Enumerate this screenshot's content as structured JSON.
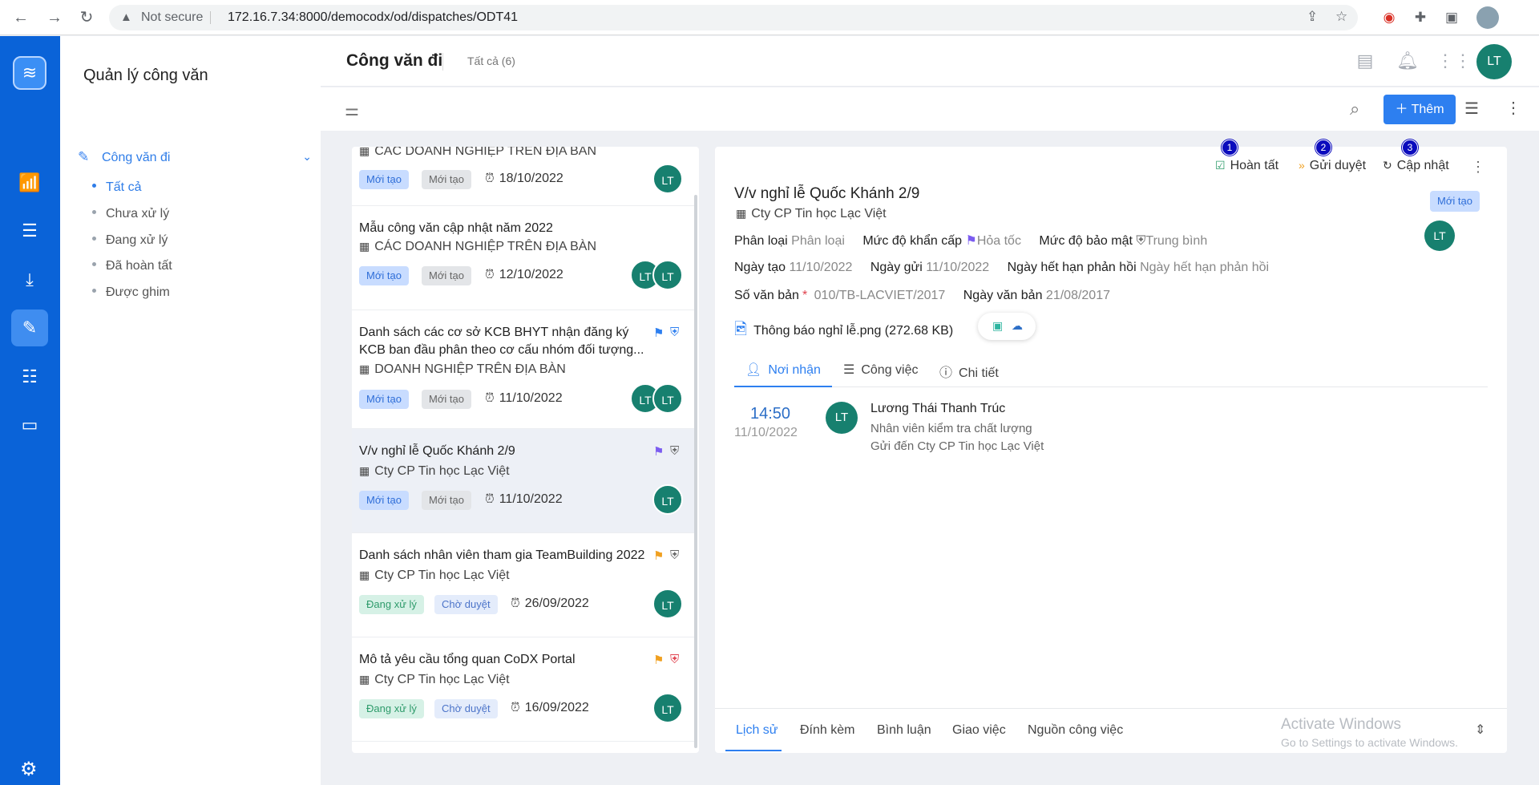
{
  "browser": {
    "not_secure": "Not secure",
    "url": "172.16.7.34:8000/democodx/od/dispatches/ODT41"
  },
  "sidebar": {
    "module_title": "Quản lý công văn",
    "group_label": "Công văn đi",
    "items": [
      {
        "label": "Tất cả",
        "active": true
      },
      {
        "label": "Chưa xử lý",
        "active": false
      },
      {
        "label": "Đang xử lý",
        "active": false
      },
      {
        "label": "Đã hoàn tất",
        "active": false
      },
      {
        "label": "Được ghim",
        "active": false
      }
    ]
  },
  "header": {
    "title": "Công văn đi",
    "count_label": "Tất cả (6)",
    "avatar": "LT"
  },
  "toolbar": {
    "add_label": "Thêm"
  },
  "list": {
    "items": [
      {
        "title": "",
        "org": "CÁC DOANH NGHIỆP TRÊN ĐỊA BÀN",
        "status1": "Mới tạo",
        "status2": "Mới tạo",
        "date": "18/10/2022",
        "avatars": [
          "LT"
        ]
      },
      {
        "title": "Mẫu công văn cập nhật năm 2022",
        "org": "CÁC DOANH NGHIỆP TRÊN ĐỊA BÀN",
        "status1": "Mới tạo",
        "status2": "Mới tạo",
        "date": "12/10/2022",
        "avatars": [
          "LT",
          "LT"
        ]
      },
      {
        "title": "Danh sách các cơ sở KCB BHYT nhận đăng ký KCB ban đầu phân theo cơ cấu nhóm đối tượng...",
        "org": "DOANH NGHIỆP TRÊN ĐỊA BÀN",
        "status1": "Mới tạo",
        "status2": "Mới tạo",
        "date": "11/10/2022",
        "avatars": [
          "LT",
          "LT"
        ]
      },
      {
        "title": "V/v nghỉ lễ Quốc Khánh 2/9",
        "org": "Cty CP Tin học Lạc Việt",
        "status1": "Mới tạo",
        "status2": "Mới tạo",
        "date": "11/10/2022",
        "avatars": [
          "LT"
        ]
      },
      {
        "title": "Danh sách nhân viên tham gia TeamBuilding 2022",
        "org": "Cty CP Tin học Lạc Việt",
        "status1": "Đang xử lý",
        "status2": "Chờ duyệt",
        "date": "26/09/2022",
        "avatars": [
          "LT"
        ]
      },
      {
        "title": "Mô tả yêu cầu tổng quan CoDX Portal",
        "org": "Cty CP Tin học Lạc Việt",
        "status1": "Đang xử lý",
        "status2": "Chờ duyệt",
        "date": "16/09/2022",
        "avatars": [
          "LT"
        ]
      }
    ]
  },
  "detail": {
    "actions": [
      {
        "num": "1",
        "label": "Hoàn tất"
      },
      {
        "num": "2",
        "label": "Gửi duyệt"
      },
      {
        "num": "3",
        "label": "Cập nhật"
      }
    ],
    "title": "V/v nghỉ lễ Quốc Khánh 2/9",
    "org": "Cty CP Tin học Lạc Việt",
    "status": "Mới tạo",
    "avatar": "LT",
    "fields": {
      "phan_loai_label": "Phân loại",
      "phan_loai_value": "Phân loại",
      "khan_cap_label": "Mức độ khẩn cấp",
      "khan_cap_value": "Hỏa tốc",
      "bao_mat_label": "Mức độ bảo mật",
      "bao_mat_value": "Trung bình",
      "ngay_tao_label": "Ngày tạo",
      "ngay_tao_value": "11/10/2022",
      "ngay_gui_label": "Ngày gửi",
      "ngay_gui_value": "11/10/2022",
      "han_phan_hoi_label": "Ngày hết hạn phản hồi",
      "han_phan_hoi_value": "Ngày hết hạn phản hồi",
      "so_van_ban_label": "Số văn bản",
      "so_van_ban_required": "*",
      "so_van_ban_value": "010/TB-LACVIET/2017",
      "ngay_van_ban_label": "Ngày văn bản",
      "ngay_van_ban_value": "21/08/2017"
    },
    "attachment": "Thông báo nghỉ lễ.png (272.68 KB)",
    "tabs": [
      {
        "label": "Nơi nhận",
        "active": true
      },
      {
        "label": "Công việc",
        "active": false
      },
      {
        "label": "Chi tiết",
        "active": false
      }
    ],
    "recipient": {
      "time": "14:50",
      "date": "11/10/2022",
      "avatar": "LT",
      "name": "Lương Thái Thanh Trúc",
      "role": "Nhân viên kiểm tra chất lượng",
      "sent_to": "Gửi đến Cty CP Tin học Lạc Việt"
    },
    "bottom_tabs": [
      {
        "label": "Lịch sử",
        "active": true
      },
      {
        "label": "Đính kèm",
        "active": false
      },
      {
        "label": "Bình luận",
        "active": false
      },
      {
        "label": "Giao việc",
        "active": false
      },
      {
        "label": "Nguồn công việc",
        "active": false
      }
    ]
  },
  "watermark": {
    "line1": "Activate Windows",
    "line2": "Go to Settings to activate Windows."
  },
  "colors": {
    "rail": "#0a63d8",
    "primary": "#2d7ff0",
    "avatar": "#17806f",
    "priority_flag": "#7b5cf0",
    "warn_flag": "#f0a020",
    "danger": "#e0414d"
  }
}
